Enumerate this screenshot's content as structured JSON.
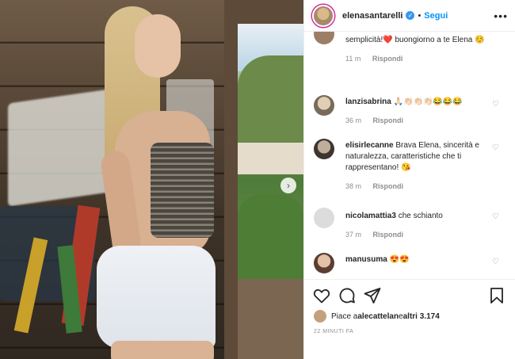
{
  "header": {
    "username": "elenasantarelli",
    "separator": "•",
    "follow_label": "Segui",
    "more_label": "•••"
  },
  "photo": {
    "next_arrow": "›"
  },
  "comments": [
    {
      "username": "",
      "text": "semplicità!❤️ buongiorno a te Elena ☺️",
      "time": "11 m",
      "reply": "Rispondi"
    },
    {
      "username": "lanzisabrina",
      "text": "🙏🏻👏🏻👏🏻👏🏻😂😂😂",
      "time": "36 m",
      "reply": "Rispondi"
    },
    {
      "username": "elisirlecanne",
      "text": "Brava Elena, sincerità e naturalezza, caratteristiche che ti rappresentano! 😘",
      "time": "38 m",
      "reply": "Rispondi"
    },
    {
      "username": "nicolamattia3",
      "text": "che schianto",
      "time": "37 m",
      "reply": "Rispondi"
    },
    {
      "username": "manusuma",
      "text": "😍😍",
      "time": "",
      "reply": ""
    }
  ],
  "footer": {
    "likes_prefix": "Piace a ",
    "likes_user": "alecattelan",
    "likes_mid": " e ",
    "likes_count": "altri 3.174",
    "time_ago": "22 MINUTI FA"
  },
  "colors": {
    "accent": "#0095f6",
    "verified": "#3897f0",
    "muted": "#8e8e8e",
    "text": "#262626"
  },
  "icons": [
    "heart-icon",
    "comment-icon",
    "share-icon",
    "bookmark-icon",
    "more-options-icon",
    "verified-badge-icon",
    "next-arrow-icon"
  ]
}
